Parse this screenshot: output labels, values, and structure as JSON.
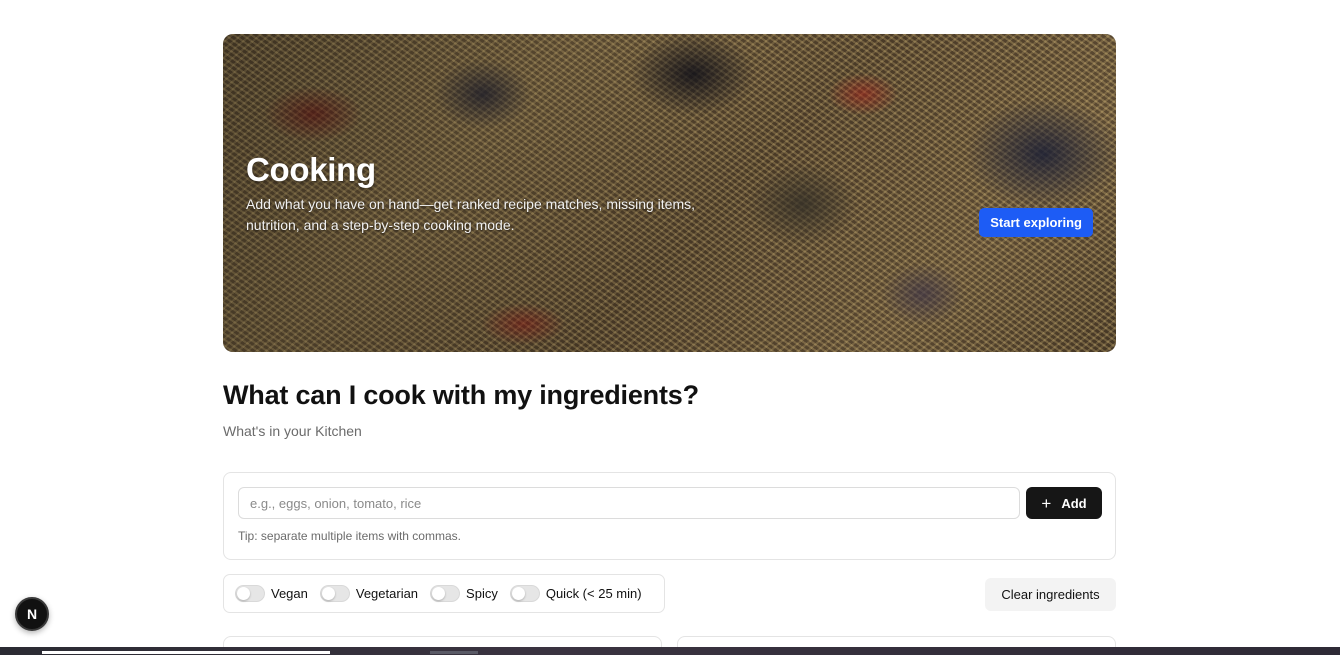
{
  "hero": {
    "title": "Cooking",
    "subtitle": "Add what you have on hand—get ranked recipe matches, missing items, nutrition, and a step-by-step cooking mode.",
    "cta_label": "Start exploring",
    "cta_color": "#1d5cf5"
  },
  "main": {
    "title": "What can I cook with my ingredients?",
    "subtitle": "What's in your Kitchen"
  },
  "ingredients": {
    "input_value": "",
    "input_placeholder": "e.g., eggs, onion, tomato, rice",
    "add_label": "Add",
    "add_icon": "plus-icon",
    "tip": "Tip: separate multiple items with commas."
  },
  "filters": [
    {
      "label": "Vegan",
      "enabled": false
    },
    {
      "label": "Vegetarian",
      "enabled": false
    },
    {
      "label": "Spicy",
      "enabled": false
    },
    {
      "label": "Quick (< 25 min)",
      "enabled": false
    }
  ],
  "actions": {
    "clear_label": "Clear ingredients"
  },
  "dev_badge": {
    "letter": "N"
  }
}
